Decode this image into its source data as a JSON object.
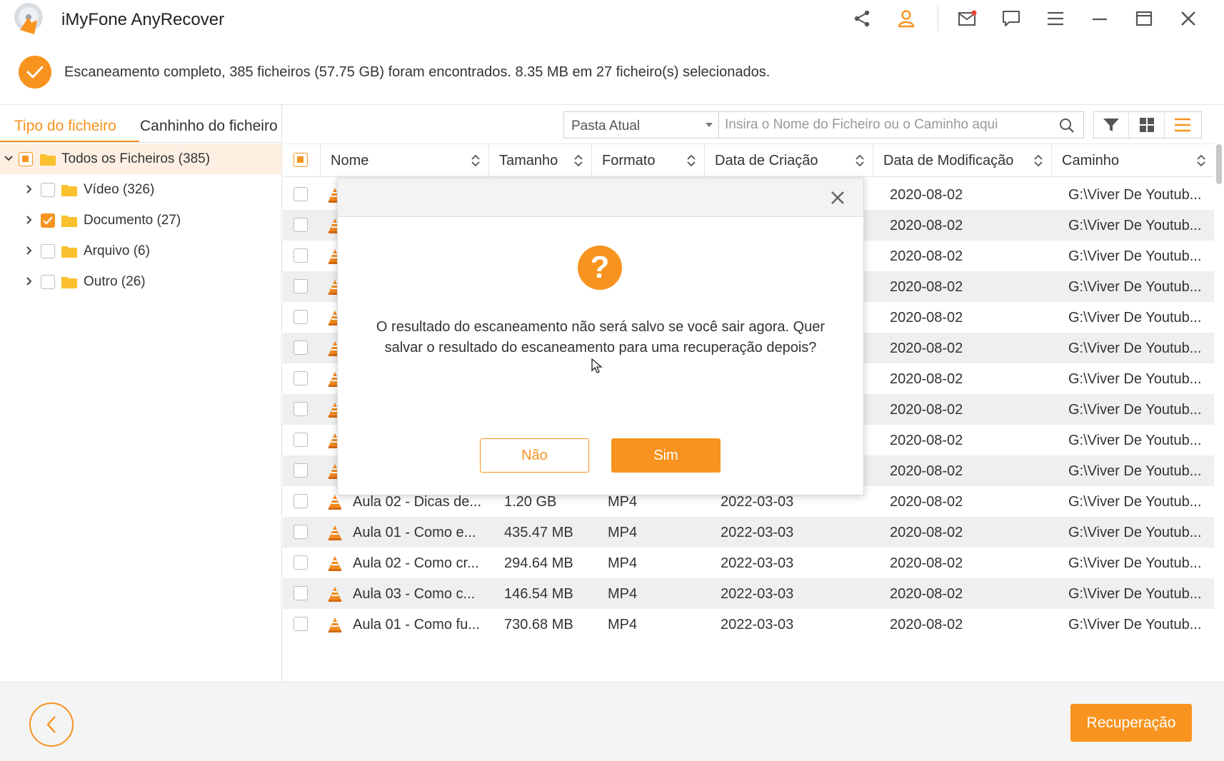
{
  "app": {
    "title": "iMyFone AnyRecover"
  },
  "colors": {
    "accent": "#f7931e",
    "row_alt": "#efefef"
  },
  "window_controls": [
    "share-icon",
    "user-icon",
    "mail-icon",
    "feedback-icon",
    "menu-icon",
    "minimize-icon",
    "maximize-icon",
    "close-icon"
  ],
  "status": {
    "text": "Escaneamento completo, 385 ficheiros (57.75 GB) foram encontrados. 8.35 MB em 27 ficheiro(s) selecionados."
  },
  "sidebar": {
    "tabs": [
      {
        "label": "Tipo do ficheiro",
        "active": true
      },
      {
        "label": "Canhinho do ficheiro",
        "active": false
      }
    ],
    "tree": [
      {
        "label": "Todos os Ficheiros (385)",
        "state": "partial",
        "expanded": true
      },
      {
        "label": "Vídeo (326)",
        "state": "unchecked"
      },
      {
        "label": "Documento (27)",
        "state": "checked"
      },
      {
        "label": "Arquivo (6)",
        "state": "unchecked"
      },
      {
        "label": "Outro (26)",
        "state": "unchecked"
      }
    ]
  },
  "toolbar": {
    "location_select": "Pasta Atual",
    "search_placeholder": "Insira o Nome do Ficheiro ou o Caminho aqui"
  },
  "table": {
    "columns": [
      "Nome",
      "Tamanho",
      "Formato",
      "Data de Criação",
      "Data de Modificação",
      "Caminho"
    ],
    "rows": [
      {
        "name": "",
        "size": "",
        "format": "",
        "created": "",
        "modified": "2020-08-02",
        "path": "G:\\Viver De Youtub..."
      },
      {
        "name": "",
        "size": "",
        "format": "",
        "created": "",
        "modified": "2020-08-02",
        "path": "G:\\Viver De Youtub..."
      },
      {
        "name": "",
        "size": "",
        "format": "",
        "created": "",
        "modified": "2020-08-02",
        "path": "G:\\Viver De Youtub..."
      },
      {
        "name": "",
        "size": "",
        "format": "",
        "created": "",
        "modified": "2020-08-02",
        "path": "G:\\Viver De Youtub..."
      },
      {
        "name": "",
        "size": "",
        "format": "",
        "created": "",
        "modified": "2020-08-02",
        "path": "G:\\Viver De Youtub..."
      },
      {
        "name": "",
        "size": "",
        "format": "",
        "created": "",
        "modified": "2020-08-02",
        "path": "G:\\Viver De Youtub..."
      },
      {
        "name": "",
        "size": "",
        "format": "",
        "created": "",
        "modified": "2020-08-02",
        "path": "G:\\Viver De Youtub..."
      },
      {
        "name": "",
        "size": "",
        "format": "",
        "created": "",
        "modified": "2020-08-02",
        "path": "G:\\Viver De Youtub..."
      },
      {
        "name": "",
        "size": "",
        "format": "",
        "created": "",
        "modified": "2020-08-02",
        "path": "G:\\Viver De Youtub..."
      },
      {
        "name": "",
        "size": "",
        "format": "",
        "created": "",
        "modified": "2020-08-02",
        "path": "G:\\Viver De Youtub..."
      },
      {
        "name": "Aula 02 - Dicas de...",
        "size": "1.20 GB",
        "format": "MP4",
        "created": "2022-03-03",
        "modified": "2020-08-02",
        "path": "G:\\Viver De Youtub..."
      },
      {
        "name": "Aula 01 - Como e...",
        "size": "435.47 MB",
        "format": "MP4",
        "created": "2022-03-03",
        "modified": "2020-08-02",
        "path": "G:\\Viver De Youtub..."
      },
      {
        "name": "Aula 02 - Como cr...",
        "size": "294.64 MB",
        "format": "MP4",
        "created": "2022-03-03",
        "modified": "2020-08-02",
        "path": "G:\\Viver De Youtub..."
      },
      {
        "name": "Aula 03 - Como c...",
        "size": "146.54 MB",
        "format": "MP4",
        "created": "2022-03-03",
        "modified": "2020-08-02",
        "path": "G:\\Viver De Youtub..."
      },
      {
        "name": "Aula 01 - Como fu...",
        "size": "730.68 MB",
        "format": "MP4",
        "created": "2022-03-03",
        "modified": "2020-08-02",
        "path": "G:\\Viver De Youtub..."
      }
    ]
  },
  "dialog": {
    "message": "O resultado do escaneamento não será salvo se você sair agora. Quer salvar o resultado do escaneamento para uma recuperação depois?",
    "no_label": "Não",
    "yes_label": "Sim"
  },
  "footer": {
    "recover_label": "Recuperação"
  }
}
